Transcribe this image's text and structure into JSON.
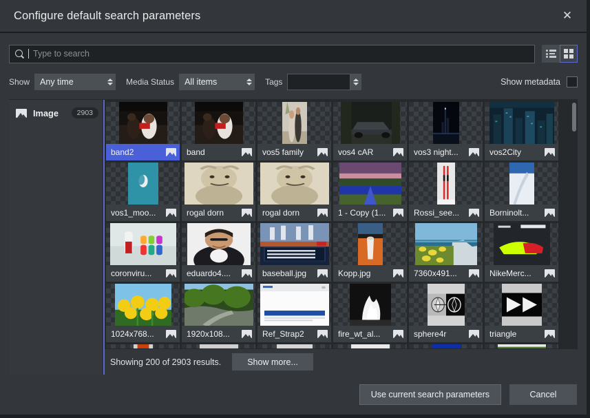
{
  "window": {
    "title": "Configure default search parameters",
    "close_icon": "close-icon"
  },
  "search": {
    "placeholder": "Type to search",
    "value": "",
    "icon": "search-icon"
  },
  "view_toggle": {
    "list_label": "list-view",
    "grid_label": "grid-view",
    "selected": "grid"
  },
  "filters": {
    "show_label": "Show",
    "show_value": "Any time",
    "media_status_label": "Media Status",
    "media_status_value": "All items",
    "tags_label": "Tags",
    "tags_value": "",
    "show_metadata_label": "Show metadata",
    "show_metadata_checked": false
  },
  "sidebar": {
    "items": [
      {
        "label": "Image",
        "count": "2903",
        "icon": "picture-icon",
        "selected": false
      }
    ]
  },
  "status": {
    "text": "Showing 200 of 2903 results.",
    "show_more_label": "Show more..."
  },
  "footer": {
    "use_params_label": "Use current search parameters",
    "cancel_label": "Cancel"
  },
  "grid": {
    "items": [
      {
        "name": "band2",
        "selected": true,
        "img": "band2"
      },
      {
        "name": "band",
        "selected": false,
        "img": "band"
      },
      {
        "name": "vos5 family",
        "selected": false,
        "img": "vos5family"
      },
      {
        "name": "vos4 cAR",
        "selected": false,
        "img": "vos4car"
      },
      {
        "name": "vos3 night...",
        "selected": false,
        "img": "vos3night"
      },
      {
        "name": "vos2City",
        "selected": false,
        "img": "vos2city"
      },
      {
        "name": "vos1_moo...",
        "selected": false,
        "img": "vos1moon"
      },
      {
        "name": "rogal dorn",
        "selected": false,
        "img": "rogaldorn"
      },
      {
        "name": "rogal dorn",
        "selected": false,
        "img": "rogaldorn2"
      },
      {
        "name": "1 - Copy (1...",
        "selected": false,
        "img": "copy1"
      },
      {
        "name": "Rossi_see...",
        "selected": false,
        "img": "rossi"
      },
      {
        "name": "Borninolt...",
        "selected": false,
        "img": "borninolt"
      },
      {
        "name": "coronviru...",
        "selected": false,
        "img": "corona"
      },
      {
        "name": "eduardo4....",
        "selected": false,
        "img": "eduardo"
      },
      {
        "name": "baseball.jpg",
        "selected": false,
        "img": "baseball"
      },
      {
        "name": "Kopp.jpg",
        "selected": false,
        "img": "kopp"
      },
      {
        "name": "7360x491...",
        "selected": false,
        "img": "cliffs"
      },
      {
        "name": "NikeMerc...",
        "selected": false,
        "img": "nike"
      },
      {
        "name": "1024x768...",
        "selected": false,
        "img": "tulips"
      },
      {
        "name": "1920x108...",
        "selected": false,
        "img": "forest"
      },
      {
        "name": "Ref_Strap2",
        "selected": false,
        "img": "refstrap"
      },
      {
        "name": "fire_wt_al...",
        "selected": false,
        "img": "fire"
      },
      {
        "name": "sphere4r",
        "selected": false,
        "img": "sphere"
      },
      {
        "name": "triangle",
        "selected": false,
        "img": "triangle"
      }
    ],
    "partial_row": [
      {
        "img": "sunset"
      },
      {
        "img": "grey1"
      },
      {
        "img": "grey2"
      },
      {
        "img": "greyhead"
      },
      {
        "img": "blue"
      },
      {
        "img": "green"
      }
    ]
  },
  "colors": {
    "accent": "#4a60d8",
    "dialog_bg": "#33373b",
    "panel_bg": "#26292c",
    "text": "#eceef0"
  }
}
